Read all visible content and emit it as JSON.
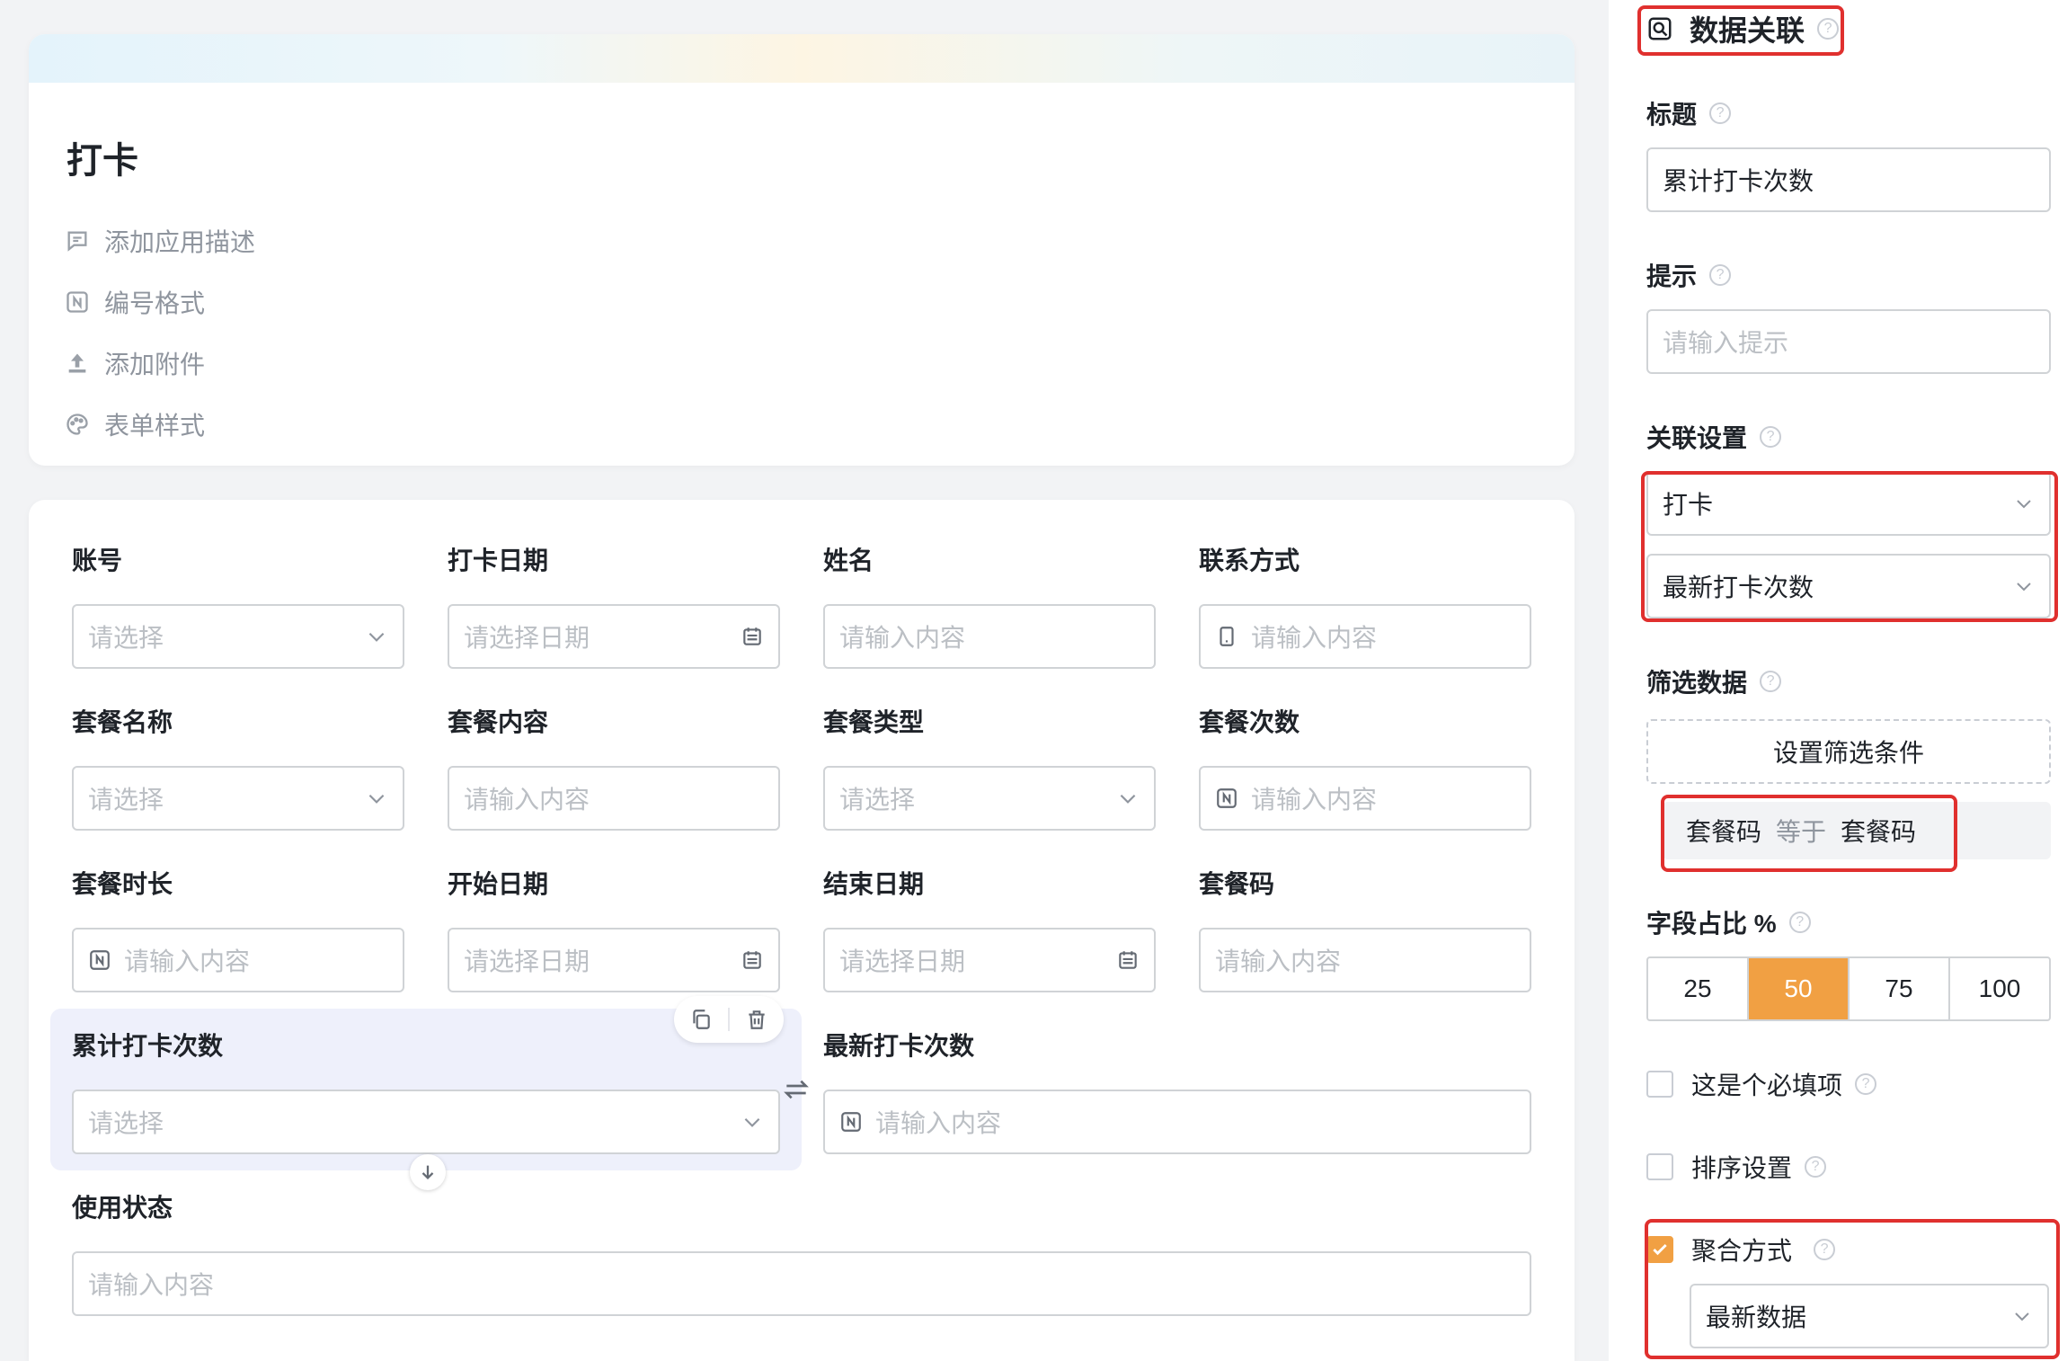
{
  "form": {
    "title": "打卡",
    "meta": [
      {
        "icon": "comment-icon",
        "label": "添加应用描述"
      },
      {
        "icon": "numbering-icon",
        "label": "编号格式"
      },
      {
        "icon": "upload-icon",
        "label": "添加附件"
      },
      {
        "icon": "palette-icon",
        "label": "表单样式"
      }
    ],
    "fields": [
      {
        "label": "账号",
        "placeholder": "请选择",
        "kind": "select"
      },
      {
        "label": "打卡日期",
        "placeholder": "请选择日期",
        "kind": "date"
      },
      {
        "label": "姓名",
        "placeholder": "请输入内容",
        "kind": "text"
      },
      {
        "label": "联系方式",
        "placeholder": "请输入内容",
        "kind": "phone"
      },
      {
        "label": "套餐名称",
        "placeholder": "请选择",
        "kind": "select"
      },
      {
        "label": "套餐内容",
        "placeholder": "请输入内容",
        "kind": "text"
      },
      {
        "label": "套餐类型",
        "placeholder": "请选择",
        "kind": "select"
      },
      {
        "label": "套餐次数",
        "placeholder": "请输入内容",
        "kind": "number"
      },
      {
        "label": "套餐时长",
        "placeholder": "请输入内容",
        "kind": "number"
      },
      {
        "label": "开始日期",
        "placeholder": "请选择日期",
        "kind": "date"
      },
      {
        "label": "结束日期",
        "placeholder": "请选择日期",
        "kind": "date"
      },
      {
        "label": "套餐码",
        "placeholder": "请输入内容",
        "kind": "text"
      },
      {
        "label": "累计打卡次数",
        "placeholder": "请选择",
        "kind": "select"
      },
      {
        "label": "最新打卡次数",
        "placeholder": "请输入内容",
        "kind": "number"
      },
      {
        "label": "使用状态",
        "placeholder": "请输入内容",
        "kind": "text"
      }
    ]
  },
  "panel": {
    "title": "数据关联",
    "title_label": "标题",
    "title_value": "累计打卡次数",
    "hint_label": "提示",
    "hint_placeholder": "请输入提示",
    "relation_label": "关联设置",
    "relation_form": "打卡",
    "relation_field": "最新打卡次数",
    "filter_label": "筛选数据",
    "filter_button": "设置筛选条件",
    "filter_condition": {
      "left": "套餐码",
      "op": "等于",
      "right": "套餐码"
    },
    "width_label": "字段占比 %",
    "width_options": [
      "25",
      "50",
      "75",
      "100"
    ],
    "width_selected": "50",
    "required_label": "这是个必填项",
    "required_checked": false,
    "sort_label": "排序设置",
    "sort_checked": false,
    "aggregate_label": "聚合方式",
    "aggregate_checked": true,
    "aggregate_value": "最新数据",
    "help_glyph": "?"
  },
  "colors": {
    "accent": "#f1a043",
    "highlight": "#e0302e",
    "selected_bg": "#eef0fb"
  }
}
